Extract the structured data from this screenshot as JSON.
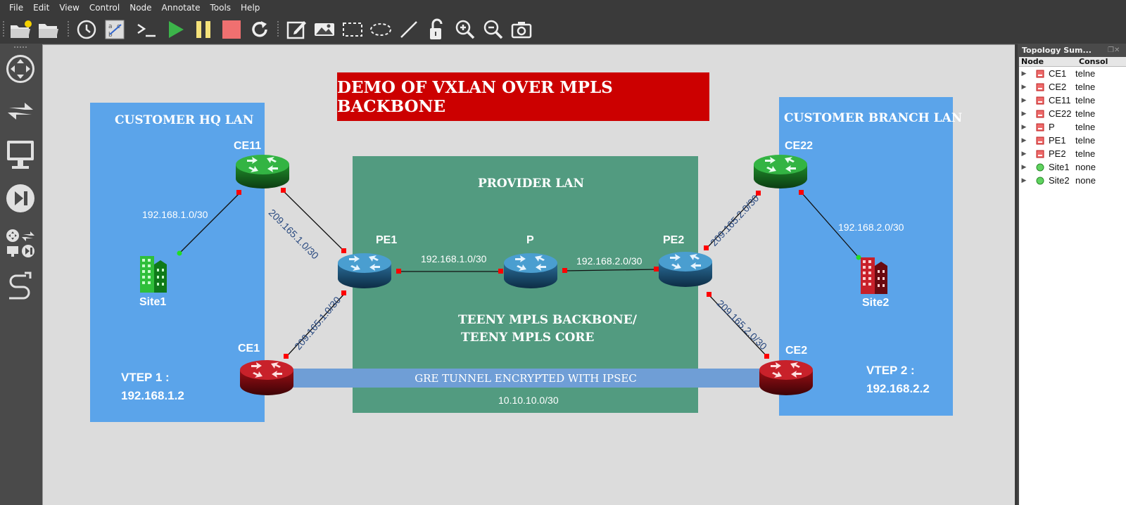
{
  "menu": [
    "File",
    "Edit",
    "View",
    "Control",
    "Node",
    "Annotate",
    "Tools",
    "Help"
  ],
  "toolbar_icons": [
    "new-project-icon",
    "open-project-icon",
    "snapshot-icon",
    "show-interface-labels-icon",
    "console-icon",
    "start-icon",
    "pause-icon",
    "stop-icon",
    "reload-icon",
    "note-icon",
    "image-icon",
    "rectangle-icon",
    "ellipse-icon",
    "line-icon",
    "lock-icon",
    "zoom-in-icon",
    "zoom-out-icon",
    "screenshot-icon"
  ],
  "left_dock_icons": [
    "routers-icon",
    "switches-icon",
    "end-devices-icon",
    "security-devices-icon",
    "all-devices-icon",
    "add-link-icon"
  ],
  "canvas": {
    "title": "DEMO OF VXLAN OVER MPLS BACKBONE",
    "zones": {
      "hq": "CUSTOMER HQ LAN",
      "provider": "PROVIDER LAN",
      "branch": "CUSTOMER BRANCH LAN",
      "backbone_line1": "TEENY MPLS BACKBONE/",
      "backbone_line2": "TEENY MPLS CORE"
    },
    "nodes": {
      "ce11": "CE11",
      "ce1": "CE1",
      "pe1": "PE1",
      "p": "P",
      "pe2": "PE2",
      "ce22": "CE22",
      "ce2": "CE2",
      "site1": "Site1",
      "site2": "Site2"
    },
    "networks": {
      "site1_ce11": "192.168.1.0/30",
      "ce11_pe1": "209.165.1.0/30",
      "ce1_pe1": "209.165.1.0/30",
      "pe1_p": "192.168.1.0/30",
      "p_pe2": "192.168.2.0/30",
      "ce22_pe2": "209.165.2.0/30",
      "ce2_pe2": "209.165.2.0/30",
      "ce22_site2": "192.168.2.0/30",
      "tunnel_net": "10.10.10.0/30"
    },
    "tunnel": "GRE TUNNEL ENCRYPTED WITH IPSEC",
    "vtep1": {
      "line1": "VTEP 1 :",
      "line2": "192.168.1.2"
    },
    "vtep2": {
      "line1": "VTEP 2 :",
      "line2": "192.168.2.2"
    }
  },
  "topology_summary": {
    "title": "Topology Sum...",
    "columns": [
      "Node",
      "Consol"
    ],
    "rows": [
      {
        "name": "CE1",
        "console": "telne",
        "status": "stopped"
      },
      {
        "name": "CE2",
        "console": "telne",
        "status": "stopped"
      },
      {
        "name": "CE11",
        "console": "telne",
        "status": "stopped"
      },
      {
        "name": "CE22",
        "console": "telne",
        "status": "stopped"
      },
      {
        "name": "P",
        "console": "telne",
        "status": "stopped"
      },
      {
        "name": "PE1",
        "console": "telne",
        "status": "stopped"
      },
      {
        "name": "PE2",
        "console": "telne",
        "status": "stopped"
      },
      {
        "name": "Site1",
        "console": "none",
        "status": "started"
      },
      {
        "name": "Site2",
        "console": "none",
        "status": "started"
      }
    ]
  },
  "colors": {
    "title_banner": "#cc0000",
    "customer_lan": "#5ba4ea",
    "provider_lan": "#529b80",
    "tunnel": "#6f9ed6",
    "router_green": "#2aa836",
    "router_red": "#b0151c",
    "router_blue": "#3a8ac0",
    "port_down": "#ff0000",
    "port_up": "#22dd22"
  }
}
